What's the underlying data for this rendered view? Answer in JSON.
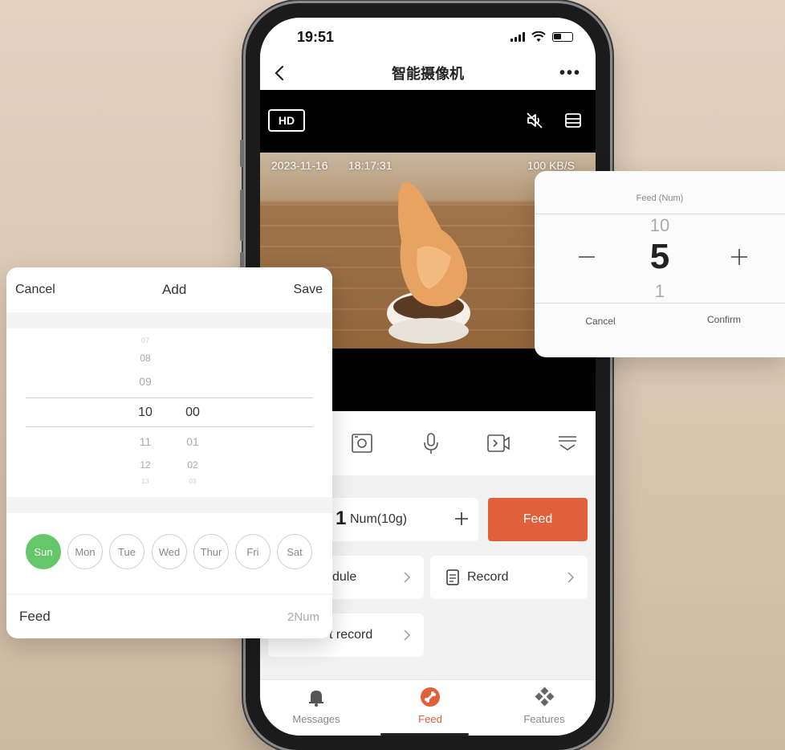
{
  "status": {
    "time": "19:51"
  },
  "nav": {
    "title": "智能摄像机",
    "more": "•••"
  },
  "video": {
    "quality_badge": "HD",
    "date": "2023-11-16",
    "time": "18:17:31",
    "rate": "100 KB/S"
  },
  "feed_controls": {
    "amount_value": "1",
    "amount_unit": "Num(10g)",
    "feed_button": "Feed",
    "schedule_label": "dule",
    "record_label": "Record",
    "feed_record_label": "t record"
  },
  "tabs": [
    {
      "label": "Messages"
    },
    {
      "label": "Feed"
    },
    {
      "label": "Features"
    }
  ],
  "add_panel": {
    "cancel": "Cancel",
    "title": "Add",
    "save": "Save",
    "hours": [
      "07",
      "08",
      "09",
      "10",
      "11",
      "12",
      "13"
    ],
    "minutes": [
      "00",
      "01",
      "02",
      "03"
    ],
    "days": [
      "Sun",
      "Mon",
      "Tue",
      "Wed",
      "Thur",
      "Fri",
      "Sat"
    ],
    "selected_day": "Sun",
    "feed_label": "Feed",
    "feed_value": "2Num"
  },
  "num_panel": {
    "title": "Feed (Num)",
    "above": "10",
    "current": "5",
    "below": "1",
    "cancel": "Cancel",
    "confirm": "Confirm"
  },
  "colors": {
    "accent": "#e0603c",
    "day_selected": "#66c76a",
    "background": "#dccbb7"
  }
}
